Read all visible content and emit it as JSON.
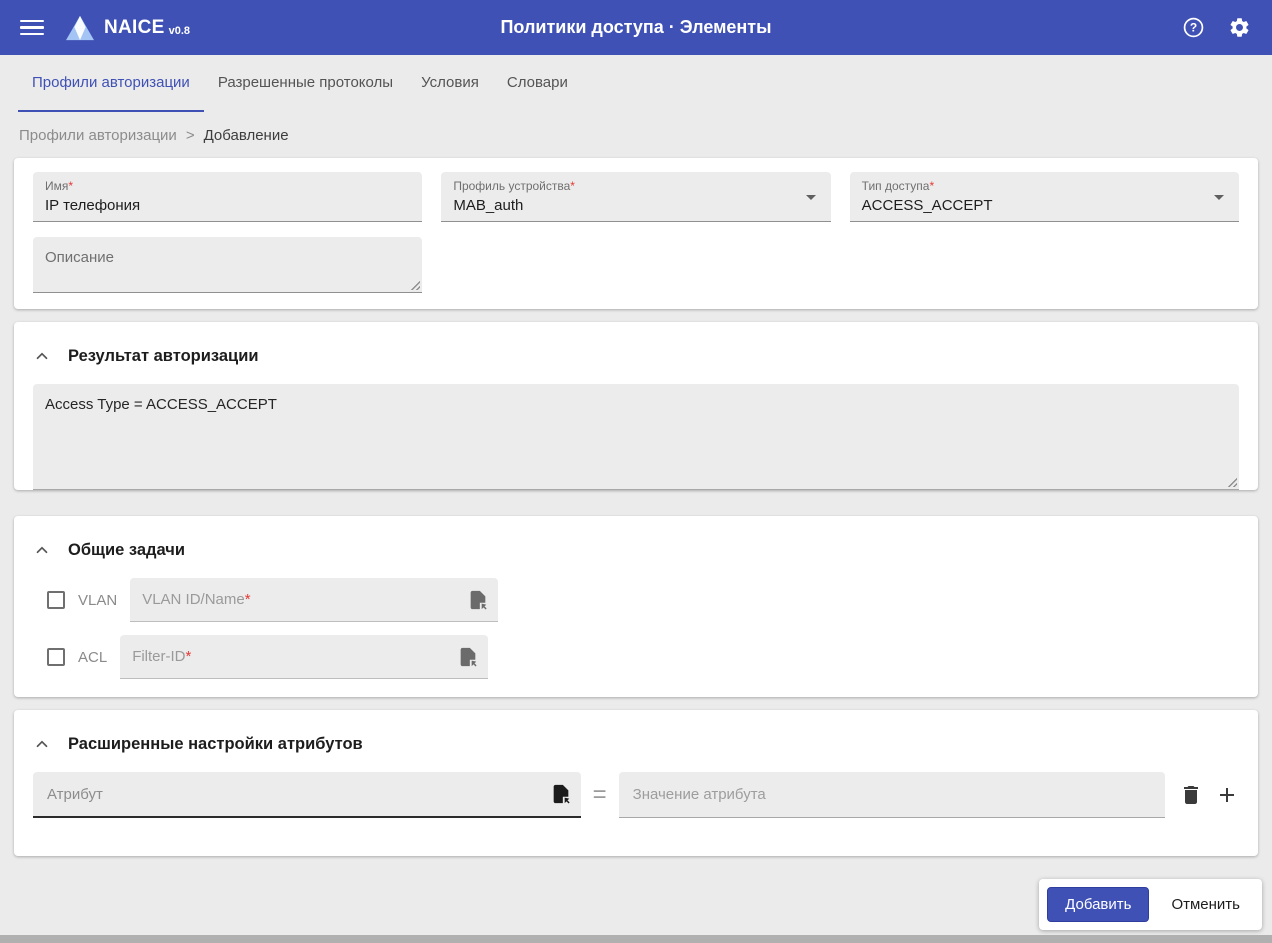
{
  "appbar": {
    "brand": "NAICE",
    "version": "v0.8",
    "title": "Политики доступа · Элементы"
  },
  "tabs": [
    {
      "label": "Профили авторизации",
      "active": true
    },
    {
      "label": "Разрешенные протоколы",
      "active": false
    },
    {
      "label": "Условия",
      "active": false
    },
    {
      "label": "Словари",
      "active": false
    }
  ],
  "breadcrumb": {
    "parent": "Профили авторизации",
    "separator": ">",
    "current": "Добавление"
  },
  "form": {
    "name": {
      "label": "Имя",
      "required_mark": "*",
      "value": "IP телефония"
    },
    "device_profile": {
      "label": "Профиль устройства",
      "required_mark": "*",
      "value": "MAB_auth"
    },
    "access_type": {
      "label": "Тип доступа",
      "required_mark": "*",
      "value": "ACCESS_ACCEPT"
    },
    "description": {
      "label": "Описание",
      "value": ""
    }
  },
  "sections": {
    "auth_result": {
      "title": "Результат авторизации",
      "content": "Access Type = ACCESS_ACCEPT"
    },
    "common_tasks": {
      "title": "Общие задачи",
      "rows": [
        {
          "checkbox": "VLAN",
          "checked": false,
          "placeholder": "VLAN ID/Name",
          "required_mark": "*"
        },
        {
          "checkbox": "ACL",
          "checked": false,
          "placeholder": "Filter-ID",
          "required_mark": "*"
        }
      ]
    },
    "advanced": {
      "title": "Расширенные настройки атрибутов",
      "attribute_placeholder": "Атрибут",
      "equals": "=",
      "value_placeholder": "Значение атрибута"
    }
  },
  "actions": {
    "add": "Добавить",
    "cancel": "Отменить"
  },
  "icons": {
    "menu": "hamburger",
    "help": "question-in-circle",
    "settings": "gear",
    "collapse": "chevron-up",
    "dropdown": "caret-down",
    "insert_from_dictionary": "document-with-arrow",
    "delete": "trash",
    "add_row": "plus"
  },
  "colors": {
    "primary": "#3f51b5",
    "required": "#e53935"
  }
}
